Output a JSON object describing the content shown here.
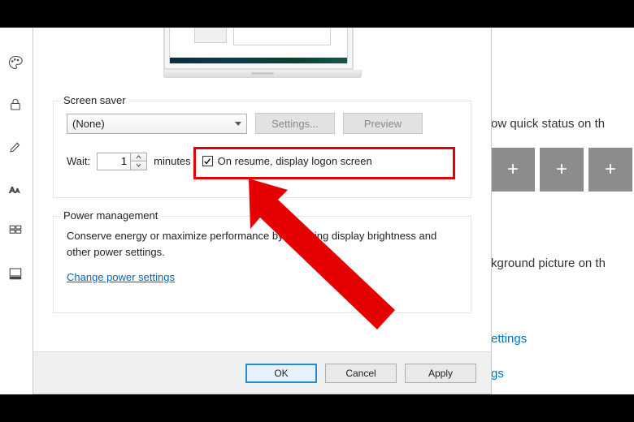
{
  "sidebar": {
    "icons": [
      "palette-icon",
      "lock-icon",
      "brush-icon",
      "font-icon",
      "grid-icon",
      "grid2-icon"
    ]
  },
  "background": {
    "quick_status_text": "ow quick status on th",
    "picture_text": "kground picture on th",
    "link1": "ettings",
    "link2": "gs"
  },
  "dialog": {
    "screensaver": {
      "legend": "Screen saver",
      "combo_value": "(None)",
      "settings_label": "Settings...",
      "preview_label": "Preview",
      "wait_label": "Wait:",
      "wait_value": "1",
      "minutes_label": "minutes",
      "checkbox_label": "On resume, display logon screen",
      "checkbox_checked": true
    },
    "power": {
      "legend": "Power management",
      "body_text": "Conserve energy or maximize performance by adjusting display brightness and other power settings.",
      "link_label": "Change power settings"
    },
    "buttons": {
      "ok": "OK",
      "cancel": "Cancel",
      "apply": "Apply"
    }
  }
}
